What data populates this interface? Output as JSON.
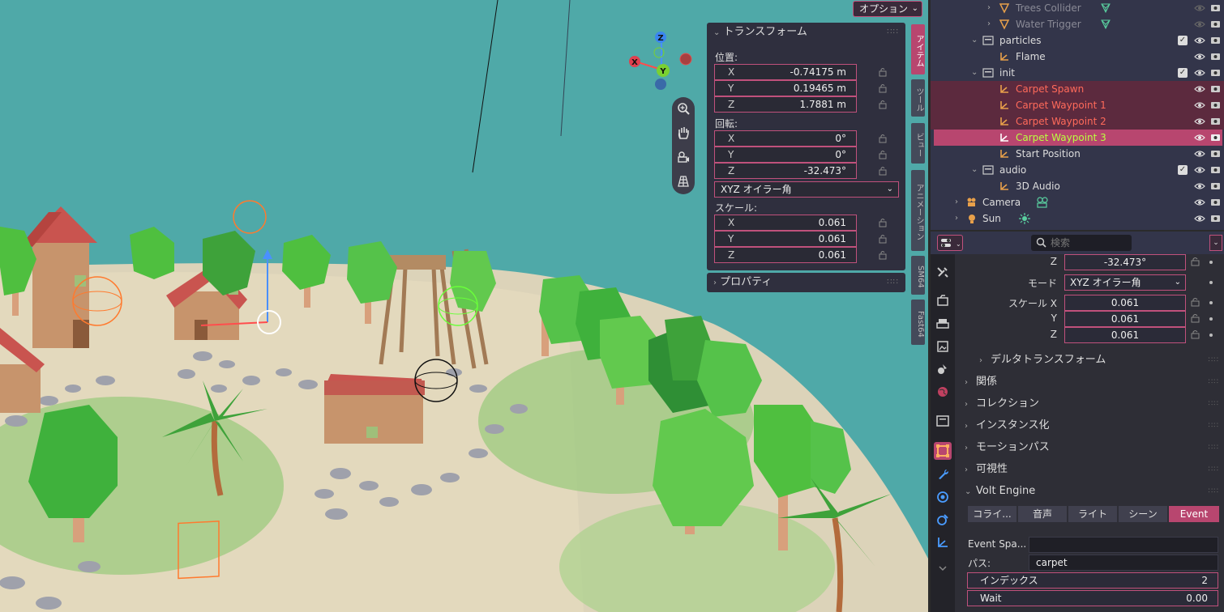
{
  "viewport": {
    "options_label": "オプション",
    "side_tabs": [
      "アイテム",
      "ツール",
      "ビュー",
      "アニメーション",
      "SM64",
      "Fast64"
    ],
    "gizmo_axes": {
      "z": "Z",
      "y": "Y",
      "x": "X"
    }
  },
  "transform_panel": {
    "title": "トランスフォーム",
    "location_label": "位置:",
    "location": [
      {
        "axis": "X",
        "value": "-0.74175 m"
      },
      {
        "axis": "Y",
        "value": "0.19465 m"
      },
      {
        "axis": "Z",
        "value": "1.7881 m"
      }
    ],
    "rotation_label": "回転:",
    "rotation": [
      {
        "axis": "X",
        "value": "0°"
      },
      {
        "axis": "Y",
        "value": "0°"
      },
      {
        "axis": "Z",
        "value": "-32.473°"
      }
    ],
    "rotation_mode": "XYZ オイラー角",
    "scale_label": "スケール:",
    "scale": [
      {
        "axis": "X",
        "value": "0.061"
      },
      {
        "axis": "Y",
        "value": "0.061"
      },
      {
        "axis": "Z",
        "value": "0.061"
      }
    ],
    "properties_label": "プロパティ"
  },
  "outliner": {
    "rows": [
      {
        "name": "Trees Collider",
        "type": "mesh",
        "state": "dim"
      },
      {
        "name": "Water Trigger",
        "type": "mesh",
        "state": "dim"
      },
      {
        "name": "particles",
        "type": "collection",
        "state": "normal"
      },
      {
        "name": "Flame",
        "type": "empty",
        "state": "normal"
      },
      {
        "name": "init",
        "type": "collection",
        "state": "normal"
      },
      {
        "name": "Carpet Spawn",
        "type": "empty",
        "state": "selected"
      },
      {
        "name": "Carpet Waypoint 1",
        "type": "empty",
        "state": "selected"
      },
      {
        "name": "Carpet Waypoint 2",
        "type": "empty",
        "state": "selected"
      },
      {
        "name": "Carpet Waypoint 3",
        "type": "empty",
        "state": "active"
      },
      {
        "name": "Start Position",
        "type": "empty",
        "state": "normal"
      },
      {
        "name": "audio",
        "type": "collection",
        "state": "normal"
      },
      {
        "name": "3D Audio",
        "type": "empty",
        "state": "normal"
      },
      {
        "name": "Camera",
        "type": "camera",
        "state": "normal"
      },
      {
        "name": "Sun",
        "type": "light",
        "state": "normal"
      }
    ]
  },
  "properties": {
    "search_placeholder": "検索",
    "rot_z_label": "Z",
    "rot_z_value": "-32.473°",
    "mode_label": "モード",
    "mode_value": "XYZ オイラー角",
    "scale_x_label": "スケール X",
    "scale_y_label": "Y",
    "scale_z_label": "Z",
    "scale_x": "0.061",
    "scale_y": "0.061",
    "scale_z": "0.061",
    "delta_transform": "デルタトランスフォーム",
    "sections": [
      "関係",
      "コレクション",
      "インスタンス化",
      "モーションパス",
      "可視性"
    ],
    "volt_engine": {
      "title": "Volt Engine",
      "tabs": [
        "コライ...",
        "音声",
        "ライト",
        "シーン",
        "Event"
      ],
      "active_tab": "Event",
      "event_space_label": "Event Spa...",
      "event_space_value": "",
      "path_label": "パス:",
      "path_value": "carpet",
      "index_label": "インデックス",
      "index_value": "2",
      "wait_label": "Wait",
      "wait_value": "0.00"
    }
  },
  "colors": {
    "accent": "#b8466f",
    "selected_text": "#ff6a5a",
    "active_text": "#b8ff40",
    "sea": "#4fa9a8"
  }
}
